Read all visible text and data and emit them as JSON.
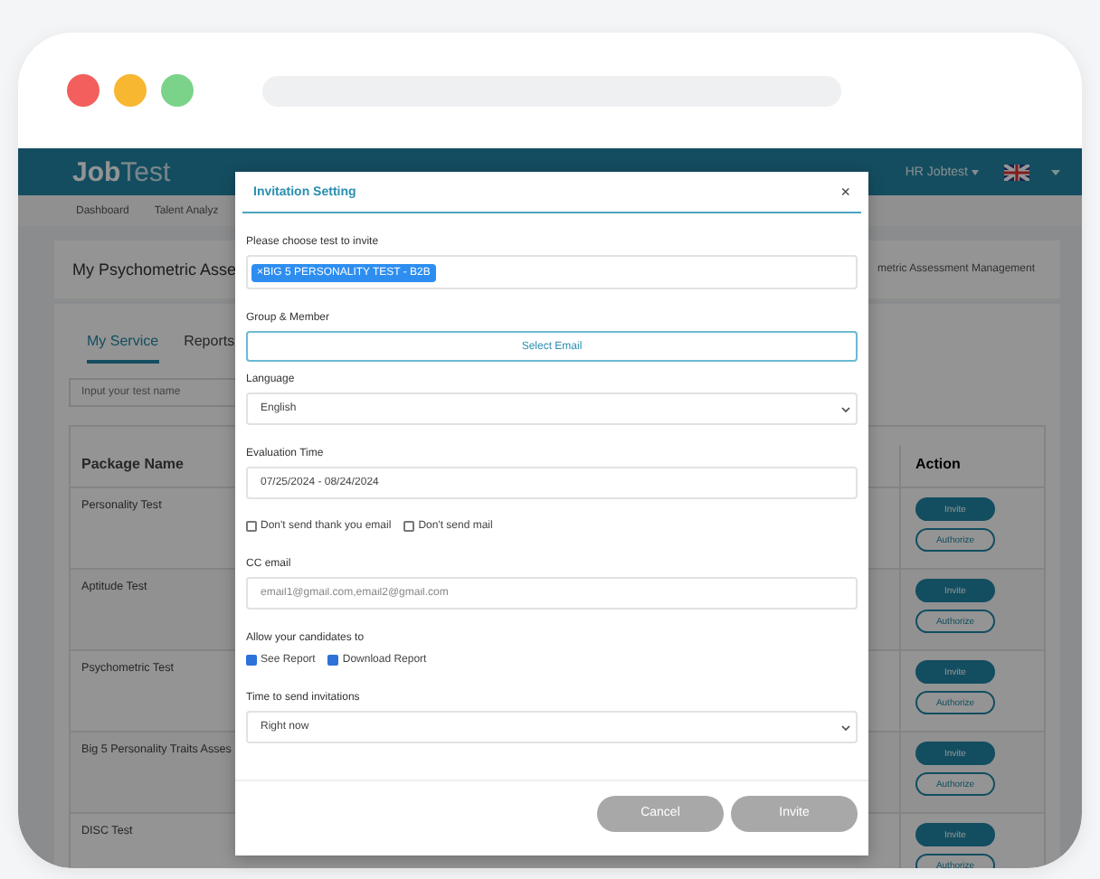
{
  "browser": {
    "dots": [
      {
        "color": "#f25f5c"
      },
      {
        "color": "#f7b731"
      },
      {
        "color": "#7bd389"
      }
    ]
  },
  "header": {
    "logo_bold": "Job",
    "logo_light": "Test",
    "user_menu": "HR Jobtest"
  },
  "breadcrumbs": [
    {
      "label": "Dashboard"
    },
    {
      "label": "Talent Analyz"
    }
  ],
  "page_title": "My Psychometric Asse",
  "page_path": "metric Assessment Management",
  "tabs": [
    {
      "label": "My Service",
      "selected": true
    },
    {
      "label": "Reports",
      "selected": false
    }
  ],
  "search": {
    "placeholder": "Input your test name"
  },
  "table": {
    "columns": [
      "Package Name",
      "Action"
    ],
    "rows": [
      {
        "name": "Personality Test",
        "actions": [
          "Invite",
          "Authorize"
        ]
      },
      {
        "name": "Aptitude Test",
        "actions": [
          "Invite",
          "Authorize"
        ]
      },
      {
        "name": "Psychometric Test",
        "actions": [
          "Invite",
          "Authorize"
        ]
      },
      {
        "name": "Big 5 Personality Traits Asses",
        "actions": [
          "Invite",
          "Authorize"
        ]
      },
      {
        "name": "DISC Test",
        "actions": [
          "Invite",
          "Authorize"
        ]
      }
    ]
  },
  "modal": {
    "title": "Invitation Setting",
    "close": "×",
    "test_label": "Please choose test to invite",
    "tests": [
      {
        "remove": "×",
        "label": "BIG 5 PERSONALITY TEST - B2B"
      }
    ],
    "group_label": "Group & Member",
    "select_email": "Select Email",
    "language_label": "Language",
    "language": "English",
    "evaluation_label": "Evaluation Time",
    "evaluation_time": "07/25/2024 - 08/24/2024",
    "mail_options": [
      {
        "label": "Don't send thank you email",
        "checked": false
      },
      {
        "label": "Don't send mail",
        "checked": false
      }
    ],
    "cc_label": "CC email",
    "cc_placeholder": "email1@gmail.com,email2@gmail.com",
    "allow_label": "Allow your candidates to",
    "permissions": [
      {
        "label": "See Report",
        "checked": true
      },
      {
        "label": "Download Report",
        "checked": true
      }
    ],
    "time_label": "Time to send invitations",
    "time_value": "Right now",
    "buttons": [
      "Cancel",
      "Invite"
    ]
  }
}
